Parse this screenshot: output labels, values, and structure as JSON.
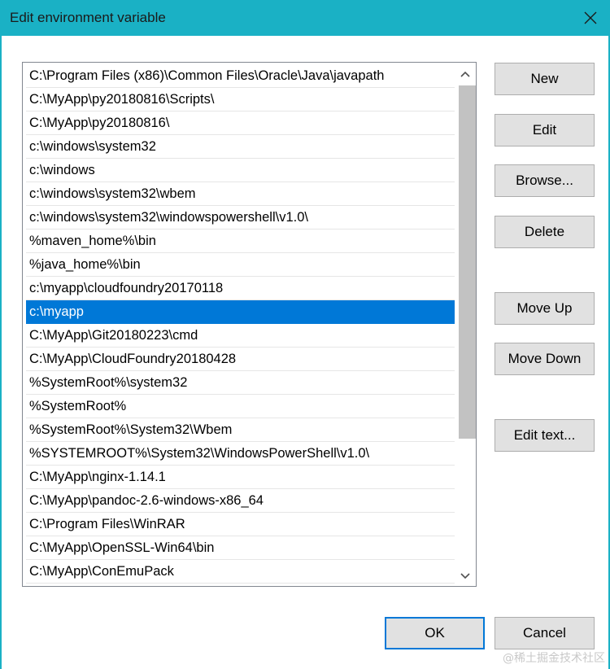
{
  "window": {
    "title": "Edit environment variable",
    "close_label": "close"
  },
  "path_list": {
    "selected_index": 10,
    "items": [
      "C:\\Program Files (x86)\\Common Files\\Oracle\\Java\\javapath",
      "C:\\MyApp\\py20180816\\Scripts\\",
      "C:\\MyApp\\py20180816\\",
      "c:\\windows\\system32",
      "c:\\windows",
      "c:\\windows\\system32\\wbem",
      "c:\\windows\\system32\\windowspowershell\\v1.0\\",
      "%maven_home%\\bin",
      "%java_home%\\bin",
      "c:\\myapp\\cloudfoundry20170118",
      "c:\\myapp",
      "C:\\MyApp\\Git20180223\\cmd",
      "C:\\MyApp\\CloudFoundry20180428",
      "%SystemRoot%\\system32",
      "%SystemRoot%",
      "%SystemRoot%\\System32\\Wbem",
      "%SYSTEMROOT%\\System32\\WindowsPowerShell\\v1.0\\",
      "C:\\MyApp\\nginx-1.14.1",
      "C:\\MyApp\\pandoc-2.6-windows-x86_64",
      "C:\\Program Files\\WinRAR",
      "C:\\MyApp\\OpenSSL-Win64\\bin",
      "C:\\MyApp\\ConEmuPack"
    ]
  },
  "buttons": {
    "new": "New",
    "edit": "Edit",
    "browse": "Browse...",
    "delete": "Delete",
    "move_up": "Move Up",
    "move_down": "Move Down",
    "edit_text": "Edit text...",
    "ok": "OK",
    "cancel": "Cancel"
  },
  "watermark": "@稀土掘金技术社区",
  "colors": {
    "titlebar": "#1ab1c5",
    "selection": "#0078d7",
    "button_face": "#e1e1e1"
  }
}
